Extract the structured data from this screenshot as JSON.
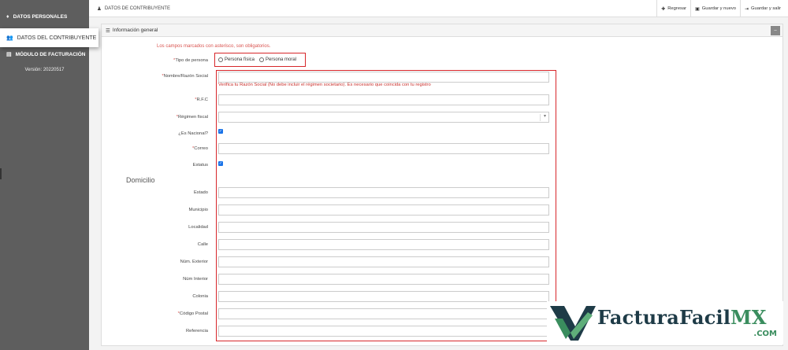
{
  "sidebar": {
    "personales_label": "DATOS PERSONALES",
    "contribuyente_label": "DATOS DEL CONTRIBUYENTE",
    "facturacion_label": "MÓDULO DE FACTURACIÓN",
    "version": "Versión: 20220517"
  },
  "topbar": {
    "title": "DATOS DE CONTRIBUYENTE",
    "regresar": "Regresar",
    "guardar_nuevo": "Guardar y nuevo",
    "guardar_salir": "Guardar y salir"
  },
  "panel": {
    "title": "Información general",
    "collapse": "–"
  },
  "form": {
    "required_note": "Los campos marcados con asterisco, son obligatorios.",
    "tipo_persona_label": "Tipo de persona",
    "persona_fisica": "Persona física",
    "persona_moral": "Persona moral",
    "nombre_label": "Nombre/Razón Social",
    "razon_warning": "Verifica tu Razón Social (No debe incluir el régimen societario). Es necesario que coincida con tu registro",
    "rfc_label": "R.F.C",
    "regimen_label": "Régimen fiscal",
    "nacional_label": "¿Es Nacional?",
    "correo_label": "Correo",
    "estatus_label": "Estatus",
    "domicilio_title": "Domicilio",
    "estado_label": "Estado",
    "municipio_label": "Municipio",
    "localidad_label": "Localidad",
    "calle_label": "Calle",
    "num_ext_label": "Núm. Exterior",
    "num_int_label": "Núm Interior",
    "colonia_label": "Colonia",
    "cp_label": "Código Postal",
    "referencia_label": "Referencia",
    "asterisk": "*",
    "check": "✓"
  },
  "logo": {
    "text_main": "FacturaFacil",
    "text_mx": "MX",
    "text_com": ".COM"
  },
  "colors": {
    "sidebar": "#5e5e5e",
    "highlight_red": "#d7262a",
    "required_red": "#d9534f",
    "checkbox_blue": "#1a73e8",
    "logo_dark": "#1e3b47",
    "logo_green": "#3a8d5e"
  }
}
